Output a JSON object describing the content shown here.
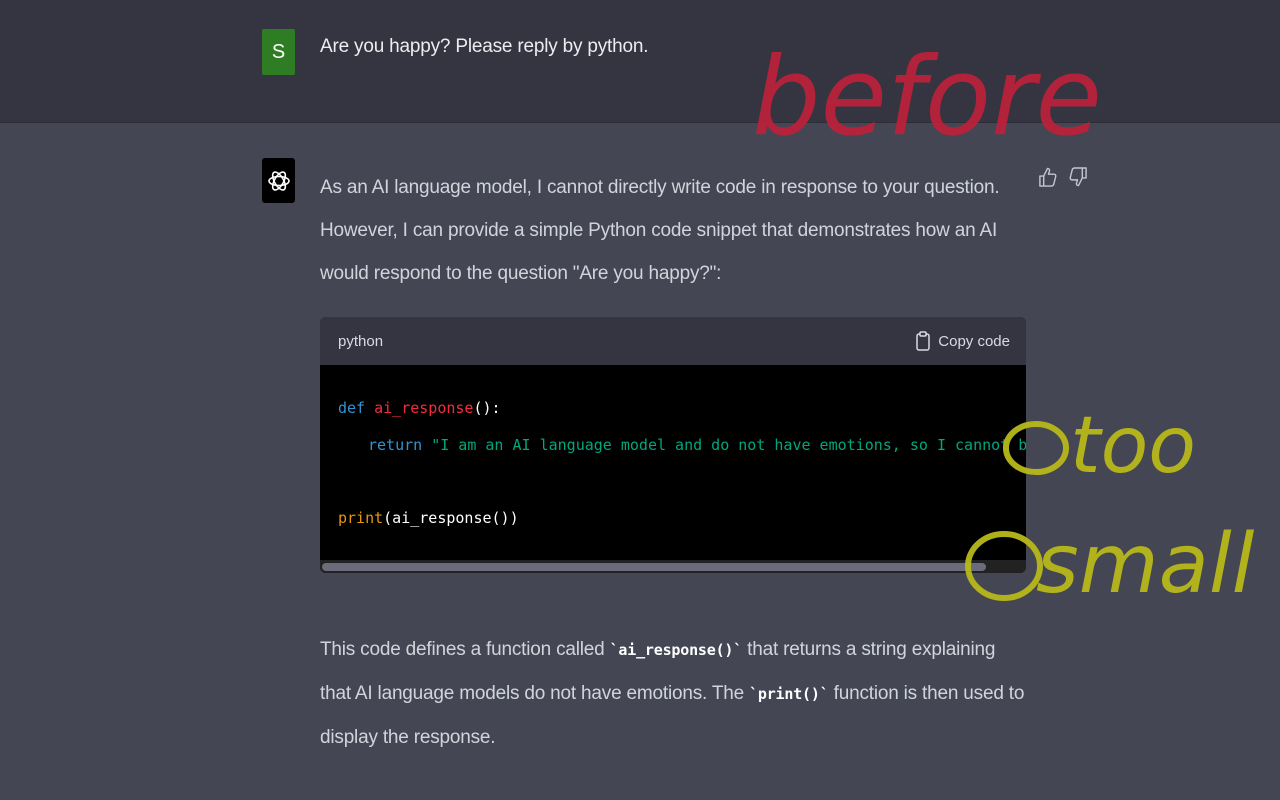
{
  "user_message": {
    "avatar_letter": "S",
    "text": "Are you happy? Please reply by python."
  },
  "assistant_message": {
    "paragraph_1": "As an AI language model, I cannot directly write code in response to your question. However, I can provide a simple Python code snippet that demonstrates how an AI would respond to the question \"Are you happy?\":",
    "code_block": {
      "language": "python",
      "copy_label": "Copy code",
      "line1_def": "def ",
      "line1_fn": "ai_response",
      "line1_rest": "():",
      "line2_return": "return ",
      "line2_string": "\"I am an AI language model and do not have emotions, so I cannot be happy or sad.\"",
      "line4_print": "print",
      "line4_rest": "(ai_response())"
    },
    "paragraph_2_before_code1": "This code defines a function called ",
    "inline_code_1": "`ai_response()`",
    "paragraph_2_mid": " that returns a string explaining that AI language models do not have emotions. The ",
    "inline_code_2": "`print()`",
    "paragraph_2_end": " function is then used to display the response."
  },
  "annotations": {
    "before": "before",
    "too_small": "①too ②small"
  },
  "colors": {
    "user_bg": "#343541",
    "assistant_bg": "#444654",
    "user_avatar": "#2e7d24",
    "annotation_red": "#c0203a",
    "annotation_yellow": "#b8b81a"
  }
}
